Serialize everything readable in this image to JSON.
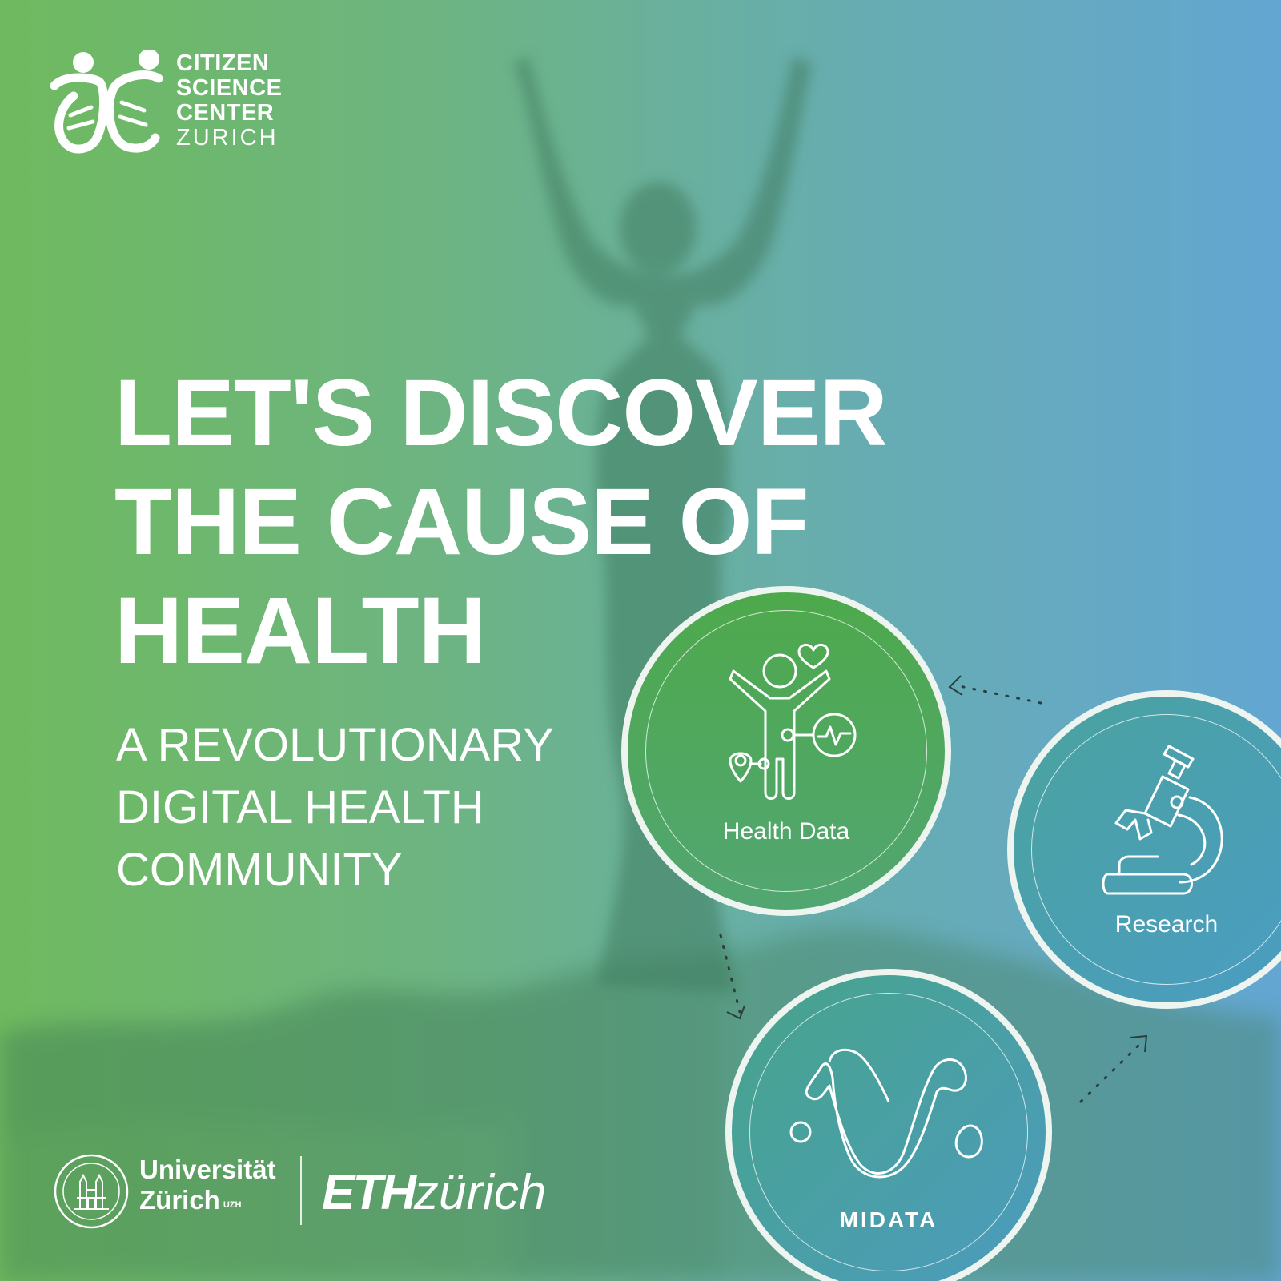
{
  "logo": {
    "line1": "CITIZEN",
    "line2": "SCIENCE",
    "line3": "CENTER",
    "line4": "ZURICH"
  },
  "headline": {
    "line1": "LET'S DISCOVER",
    "line2": "THE CAUSE OF",
    "line3": "HEALTH"
  },
  "subline": {
    "line1": "A REVOLUTIONARY",
    "line2": "DIGITAL HEALTH",
    "line3": "COMMUNITY"
  },
  "cycle": {
    "health_data_label": "Health Data",
    "research_label": "Research",
    "midata_label": "MIDATA"
  },
  "footer": {
    "uzh_line1": "Universität",
    "uzh_line2": "Zürich",
    "uzh_sup": "UZH",
    "eth_bold": "ETH",
    "eth_light": "zürich"
  },
  "colors": {
    "green": "#6fba5f",
    "blue": "#63a6d2",
    "ring": "#eef5f1"
  },
  "icons": [
    "dna-people-logo-icon",
    "person-health-icon",
    "microscope-icon",
    "midata-logo-icon",
    "uzh-seal-icon"
  ]
}
